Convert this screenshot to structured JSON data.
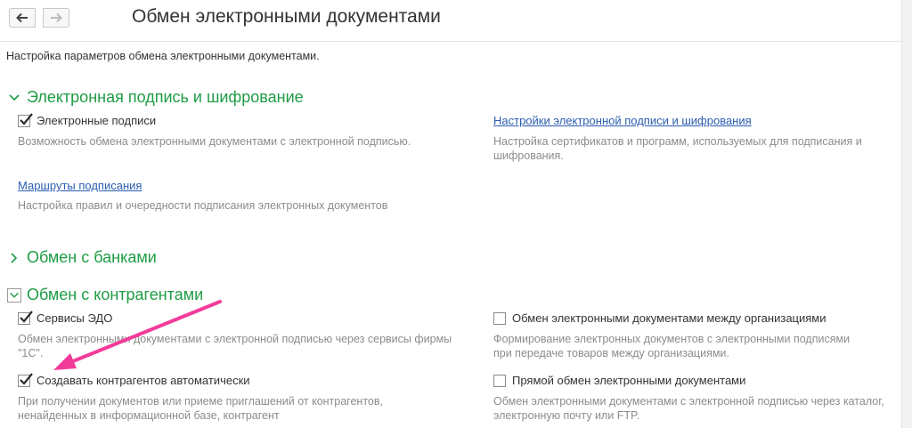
{
  "header": {
    "title": "Обмен электронными документами",
    "subtitle": "Настройка параметров обмена электронными документами."
  },
  "colors": {
    "section": "#1f9c45",
    "link": "#2a5db0",
    "arrow": "#f23b9a"
  },
  "sections": {
    "signature": {
      "title": "Электронная подпись и шифрование",
      "signatures_label": "Электронные подписи",
      "signatures_desc": "Возможность обмена электронными документами с электронной подписью.",
      "settings_link": "Настройки электронной подписи и шифрования",
      "settings_desc": "Настройка сертификатов и программ, используемых для подписания и шифрования.",
      "routes_link": "Маршруты подписания",
      "routes_desc": "Настройка правил и очередности подписания электронных документов"
    },
    "banks": {
      "title": "Обмен с банками"
    },
    "counterparties": {
      "title": "Обмен с контрагентами",
      "edo_label": "Сервисы ЭДО",
      "edo_desc": "Обмен электронными документами с электронной подписью через сервисы фирмы \"1С\".",
      "auto_label": "Создавать контрагентов автоматически",
      "auto_desc": "При получении документов или приеме приглашений от контрагентов, ненайденных в информационной базе, контрагент",
      "between_orgs_label": "Обмен электронными документами между организациями",
      "between_orgs_desc": "Формирование электронных документов с электронными подписями при передаче товаров между организациями.",
      "direct_label": "Прямой обмен электронными документами",
      "direct_desc": "Обмен электронными документами с электронной подписью через каталог, электронную почту или FTP."
    }
  }
}
